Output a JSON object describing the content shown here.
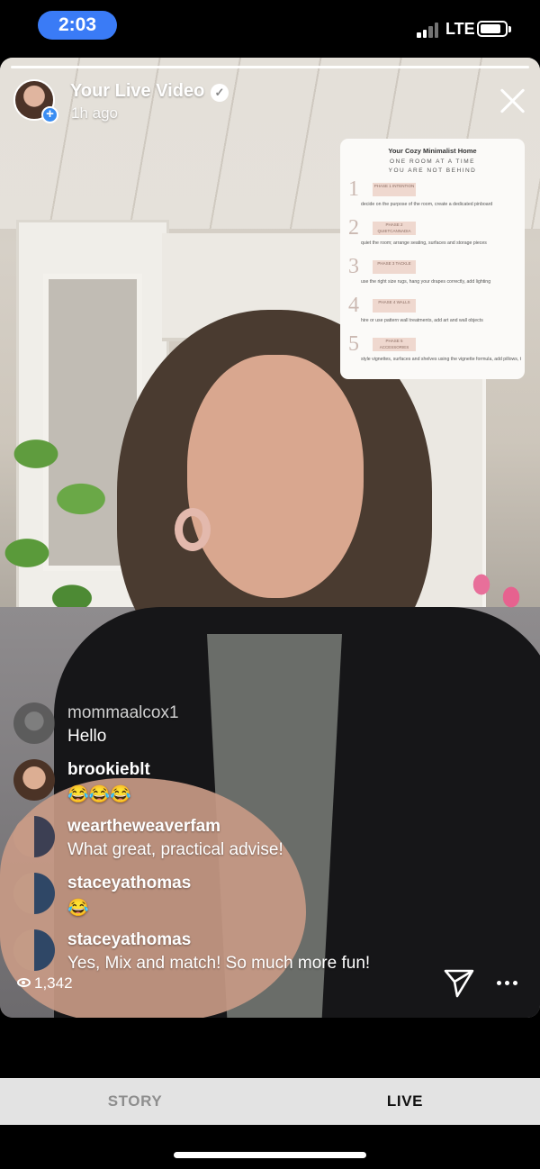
{
  "status_bar": {
    "time": "2:03",
    "network": "LTE"
  },
  "live": {
    "title": "Your Live Video",
    "time_ago": "1h ago",
    "viewers": "1,342"
  },
  "card": {
    "title": "Your Cozy Minimalist Home",
    "subtitle_line1": "ONE ROOM AT A TIME",
    "subtitle_line2": "YOU ARE NOT BEHIND",
    "phases": [
      {
        "num": "1",
        "tag": "PHASE 1 INTENTION",
        "desc": "decide on the purpose of the room, create a dedicated pinboard"
      },
      {
        "num": "2",
        "tag": "PHASE 2 QUIETCANNADIA",
        "desc": "quiet the room; arrange seating, surfaces and storage pieces"
      },
      {
        "num": "3",
        "tag": "PHASE 3 TACKLE",
        "desc": "use the right size rugs, hang your drapes correctly, add lighting"
      },
      {
        "num": "4",
        "tag": "PHASE 4 WALLS",
        "desc": "hire or use pattern wall treatments, add art and wall objects"
      },
      {
        "num": "5",
        "tag": "PHASE 5 ACCESSORIES",
        "desc": "style vignettes, surfaces and shelves using the vignette formula, add pillows, throws and plants"
      }
    ]
  },
  "comments": [
    {
      "user": "mommaalcox1",
      "text": "Hello"
    },
    {
      "user": "brookieblt",
      "text": "😂😂😂"
    },
    {
      "user": "weartheweaverfam",
      "text": "What great, practical advise!"
    },
    {
      "user": "staceyathomas",
      "text": "😂"
    },
    {
      "user": "staceyathomas",
      "text": "Yes, Mix and match! So much more fun!"
    }
  ],
  "tabs": {
    "story": "STORY",
    "live": "LIVE"
  },
  "colors": {
    "time_pill": "#3a7bf6",
    "verified_badge": "#ffffff",
    "tabbar_bg": "#e3e3e3"
  }
}
